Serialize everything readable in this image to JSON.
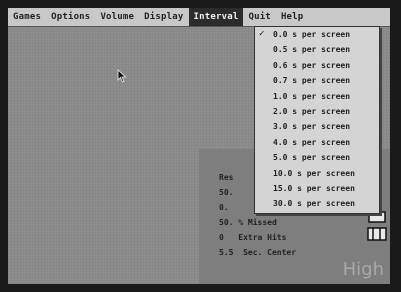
{
  "menubar": {
    "items": [
      "Games",
      "Options",
      "Volume",
      "Display",
      "Interval",
      "Quit",
      "Help"
    ],
    "active": "Interval"
  },
  "interval_menu": {
    "items": [
      "0.0 s per screen",
      "0.5 s per screen",
      "0.6 s per screen",
      "0.7 s per screen",
      "1.0 s per screen",
      "2.0 s per screen",
      "3.0 s per screen",
      "4.0 s per screen",
      "5.0 s per screen",
      "10.0 s per screen",
      "15.0 s per screen",
      "30.0 s per screen"
    ],
    "checked_index": 0,
    "check_glyph": "✓"
  },
  "stats": {
    "line1": "Res",
    "line2": "50.",
    "line3": "0.",
    "line4": "50. % Missed",
    "line5": "0   Extra Hits",
    "line6": "5.5  Sec. Center"
  },
  "brand_text": "High",
  "colors": {
    "menubar_bg": "#c8c8c8",
    "active_menu_bg": "#2b2b2b",
    "dropdown_bg": "#d4d4d4",
    "play_area": "#8e8e8e"
  }
}
